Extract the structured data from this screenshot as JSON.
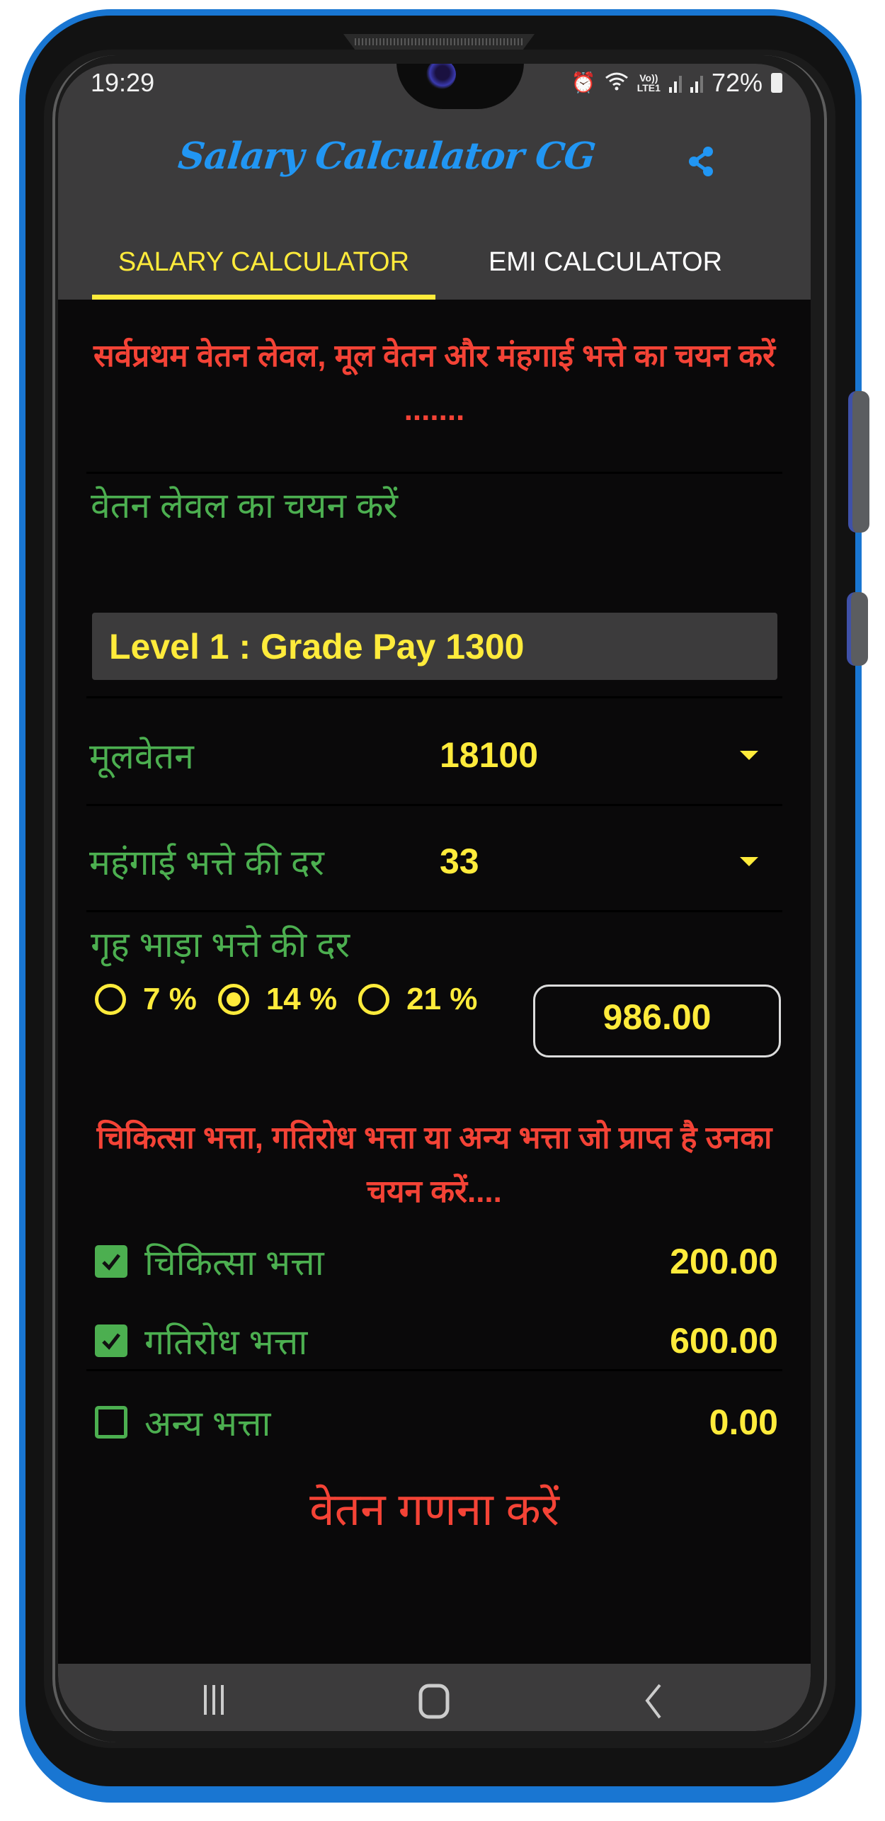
{
  "status_bar": {
    "time": "19:29",
    "icons": [
      "alarm-icon",
      "wifi-icon",
      "volte-lte-icon",
      "signal-sim1-icon",
      "signal-sim2-icon"
    ],
    "lte_top": "Vo))",
    "lte_bottom": "LTE1",
    "battery_percent": "72%"
  },
  "app_bar": {
    "title": "Salary Calculator CG",
    "share_icon": "share-icon",
    "title_color": "#2196F3"
  },
  "tabs": [
    {
      "label": "SALARY CALCULATOR",
      "active": true
    },
    {
      "label": "EMI CALCULATOR",
      "active": false
    }
  ],
  "main": {
    "heading1": "सर्वप्रथम वेतन लेवल, मूल वेतन और मंहगाई भत्ते का चयन करें .......",
    "level_label": "वेतन लेवल का चयन करें",
    "level_value": "Level 1 : Grade Pay 1300",
    "basic_pay": {
      "label": "मूलवेतन",
      "value": "18100"
    },
    "da_rate": {
      "label": "महंगाई भत्ते की दर",
      "value": "33"
    },
    "hra": {
      "label": "गृह भाड़ा भत्ते की दर",
      "options": [
        {
          "label": "7 %",
          "selected": false
        },
        {
          "label": "14 %",
          "selected": true
        },
        {
          "label": "21 %",
          "selected": false
        }
      ],
      "amount": "986.00"
    },
    "heading2": "चिकित्सा भत्ता, गतिरोध भत्ता या अन्य भत्ता जो प्राप्त है उनका चयन करें....",
    "allowances": [
      {
        "label": "चिकित्सा भत्ता",
        "checked": true,
        "amount": "200.00"
      },
      {
        "label": "गतिरोध भत्ता",
        "checked": true,
        "amount": "600.00"
      },
      {
        "label": "अन्य भत्ता",
        "checked": false,
        "amount": "0.00"
      }
    ],
    "calculate_button": "वेतन गणना करें"
  },
  "nav_bar": {
    "recents": "recents-icon",
    "home": "home-icon",
    "back": "back-icon"
  },
  "colors": {
    "accent_yellow": "#FFEB3B",
    "label_green": "#4CAF50",
    "heading_red": "#F44336",
    "app_bar_bg": "#3C3B3C",
    "phone_outline": "#1976D2"
  }
}
